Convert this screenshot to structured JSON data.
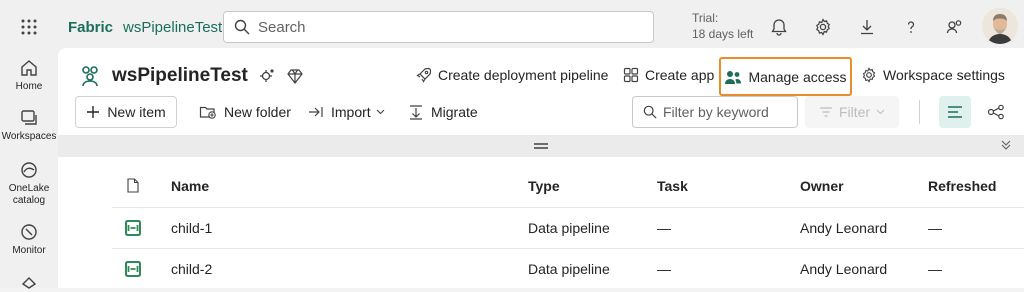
{
  "topbar": {
    "brand": "Fabric",
    "workspace_crumb": "wsPipelineTest",
    "search_placeholder": "Search",
    "trial_line1": "Trial:",
    "trial_line2": "18 days left"
  },
  "nav": {
    "home": "Home",
    "workspaces": "Workspaces",
    "onelake": "OneLake catalog",
    "monitor": "Monitor"
  },
  "workspace": {
    "name": "wsPipelineTest",
    "actions": {
      "create_pipeline": "Create deployment pipeline",
      "create_app": "Create app",
      "manage_access": "Manage access",
      "settings": "Workspace settings"
    }
  },
  "toolbar": {
    "new_item": "New item",
    "new_folder": "New folder",
    "import": "Import",
    "migrate": "Migrate",
    "filter_placeholder": "Filter by keyword",
    "filter": "Filter"
  },
  "table": {
    "columns": [
      "Name",
      "Type",
      "Task",
      "Owner",
      "Refreshed"
    ],
    "rows": [
      {
        "name": "child-1",
        "type": "Data pipeline",
        "task": "—",
        "owner": "Andy Leonard",
        "refreshed": "—"
      },
      {
        "name": "child-2",
        "type": "Data pipeline",
        "task": "—",
        "owner": "Andy Leonard",
        "refreshed": "—"
      }
    ]
  },
  "colors": {
    "brand": "#1b6e5c",
    "highlight": "#e98d2a",
    "pipeline_icon": "#2e8b57"
  }
}
